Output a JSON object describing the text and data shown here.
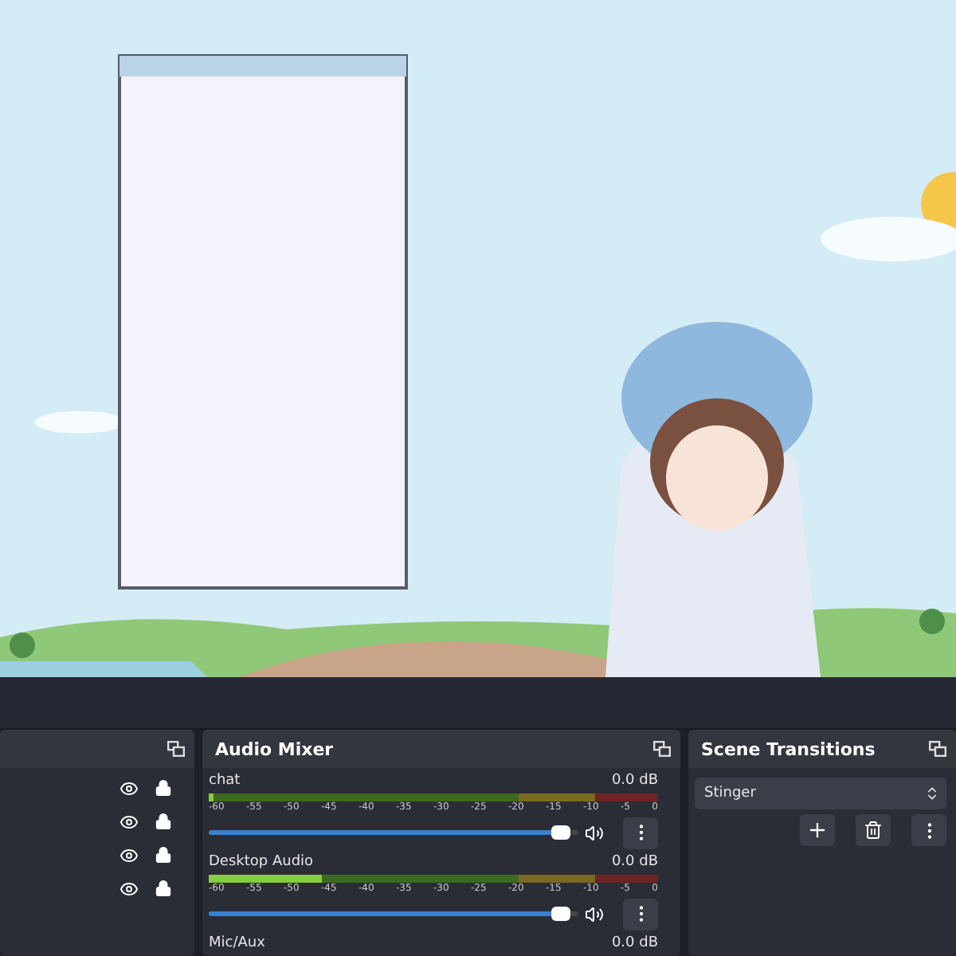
{
  "sources": {
    "rows": [
      {
        "visible": true,
        "locked": true
      },
      {
        "visible": true,
        "locked": true
      },
      {
        "visible": true,
        "locked": true
      },
      {
        "visible": true,
        "locked": true
      }
    ]
  },
  "audio_mixer": {
    "title": "Audio Mixer",
    "channels": [
      {
        "name": "chat",
        "reading": "0.0 dB",
        "meter": {
          "level": 0.01
        },
        "volume": {
          "level": 0.97
        },
        "scale": [
          "-60",
          "-55",
          "-50",
          "-45",
          "-40",
          "-35",
          "-30",
          "-25",
          "-20",
          "-15",
          "-10",
          "-5",
          "0"
        ]
      },
      {
        "name": "Desktop Audio",
        "reading": "0.0 dB",
        "meter": {
          "level": 0.25
        },
        "volume": {
          "level": 0.97
        },
        "scale": [
          "-60",
          "-55",
          "-50",
          "-45",
          "-40",
          "-35",
          "-30",
          "-25",
          "-20",
          "-15",
          "-10",
          "-5",
          "0"
        ]
      },
      {
        "name": "Mic/Aux",
        "reading": "0.0 dB"
      }
    ]
  },
  "scene_transitions": {
    "title": "Scene Transitions",
    "transition": "Stinger"
  }
}
